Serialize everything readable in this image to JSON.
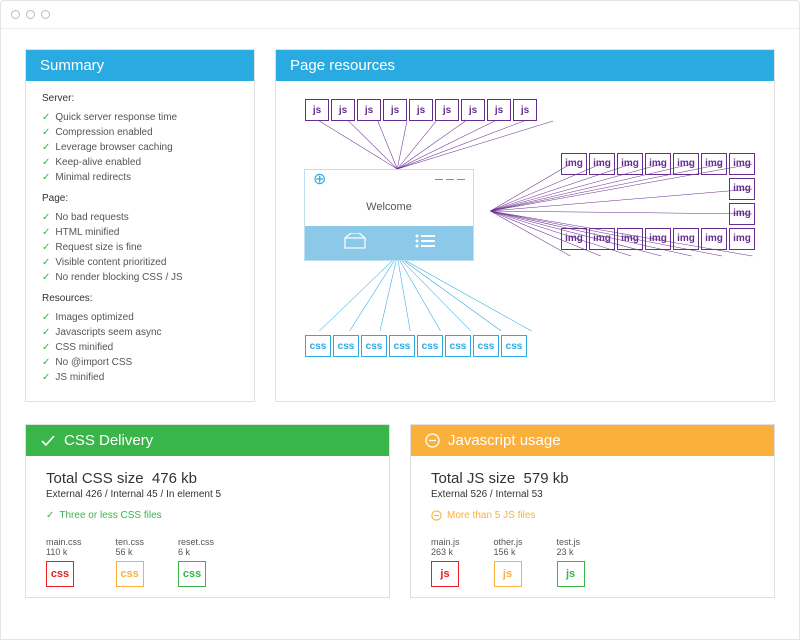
{
  "summary": {
    "title": "Summary",
    "server_label": "Server:",
    "server": [
      "Quick server response time",
      "Compression enabled",
      "Leverage browser caching",
      "Keep-alive enabled",
      "Minimal redirects"
    ],
    "page_label": "Page:",
    "page": [
      "No bad requests",
      "HTML minified",
      "Request size is fine",
      "Visible content prioritized",
      "No render blocking CSS / JS"
    ],
    "res_label": "Resources:",
    "res": [
      "Images optimized",
      "Javascripts seem async",
      "CSS minified",
      "No @import CSS",
      "JS minified"
    ]
  },
  "resources": {
    "title": "Page resources",
    "js_label": "js",
    "img_label": "img",
    "css_label": "css",
    "welcome": "Welcome",
    "js_count": 9,
    "css_count": 8,
    "img_rows": [
      7,
      1,
      1,
      7
    ]
  },
  "css_delivery": {
    "title": "CSS Delivery",
    "total_label": "Total CSS size",
    "total_value": "476 kb",
    "breakdown": "External 426 / Internal 45 / In element 5",
    "status": "Three or less CSS files",
    "files": [
      {
        "name": "main.css",
        "size": "110 k",
        "color": "red",
        "tag": "css"
      },
      {
        "name": "ten.css",
        "size": "56 k",
        "color": "ylw",
        "tag": "css"
      },
      {
        "name": "reset.css",
        "size": "6 k",
        "color": "grn",
        "tag": "css"
      }
    ]
  },
  "js_usage": {
    "title": "Javascript usage",
    "total_label": "Total JS size",
    "total_value": "579 kb",
    "breakdown": "External 526 / Internal 53",
    "status": "More than 5 JS files",
    "files": [
      {
        "name": "main.js",
        "size": "263 k",
        "color": "red",
        "tag": "js"
      },
      {
        "name": "other.js",
        "size": "156 k",
        "color": "ylw",
        "tag": "js"
      },
      {
        "name": "test.js",
        "size": "23 k",
        "color": "grn",
        "tag": "js"
      }
    ]
  }
}
